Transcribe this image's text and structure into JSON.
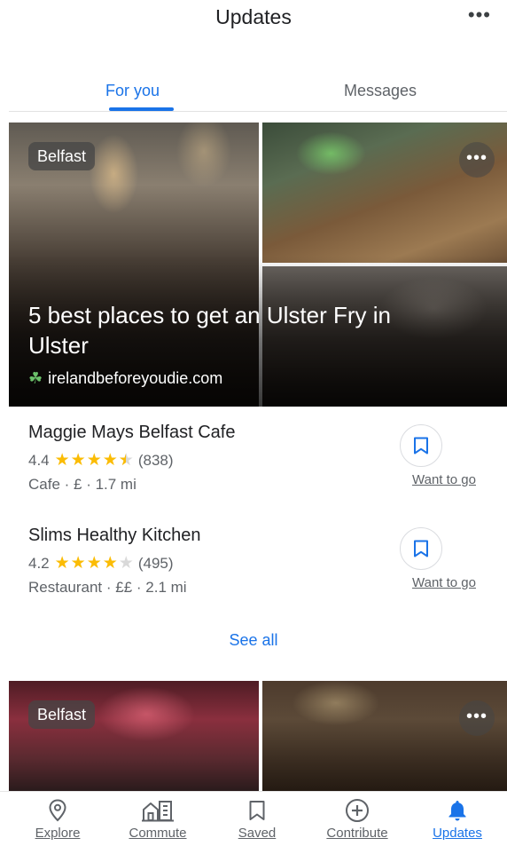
{
  "header": {
    "title": "Updates",
    "more_glyph": "•••"
  },
  "tabs": [
    {
      "label": "For you",
      "active": true
    },
    {
      "label": "Messages",
      "active": false
    }
  ],
  "feed": [
    {
      "location_chip": "Belfast",
      "more_glyph": "•••",
      "headline": "5 best places to get an Ulster Fry in Ulster",
      "source_icon": "shamrock-icon",
      "source": "irelandbeforeyoudie.com",
      "places": [
        {
          "name": "Maggie Mays Belfast Cafe",
          "rating": "4.4",
          "stars": 4.4,
          "reviews": "(838)",
          "meta": "Cafe · £ · 1.7 mi",
          "action_label": "Want to go"
        },
        {
          "name": "Slims Healthy Kitchen",
          "rating": "4.2",
          "stars": 4.2,
          "reviews": "(495)",
          "meta": "Restaurant · ££ · 2.1 mi",
          "action_label": "Want to go"
        }
      ],
      "see_all": "See all"
    },
    {
      "location_chip": "Belfast",
      "more_glyph": "•••"
    }
  ],
  "bottom_nav": [
    {
      "label": "Explore",
      "icon": "location-pin-icon",
      "active": false
    },
    {
      "label": "Commute",
      "icon": "commute-building-icon",
      "active": false
    },
    {
      "label": "Saved",
      "icon": "bookmark-icon",
      "active": false
    },
    {
      "label": "Contribute",
      "icon": "add-circle-icon",
      "active": false
    },
    {
      "label": "Updates",
      "icon": "bell-icon",
      "active": true
    }
  ],
  "colors": {
    "accent": "#1a73e8",
    "star": "#fbbc04",
    "secondary_text": "#5f6368"
  }
}
